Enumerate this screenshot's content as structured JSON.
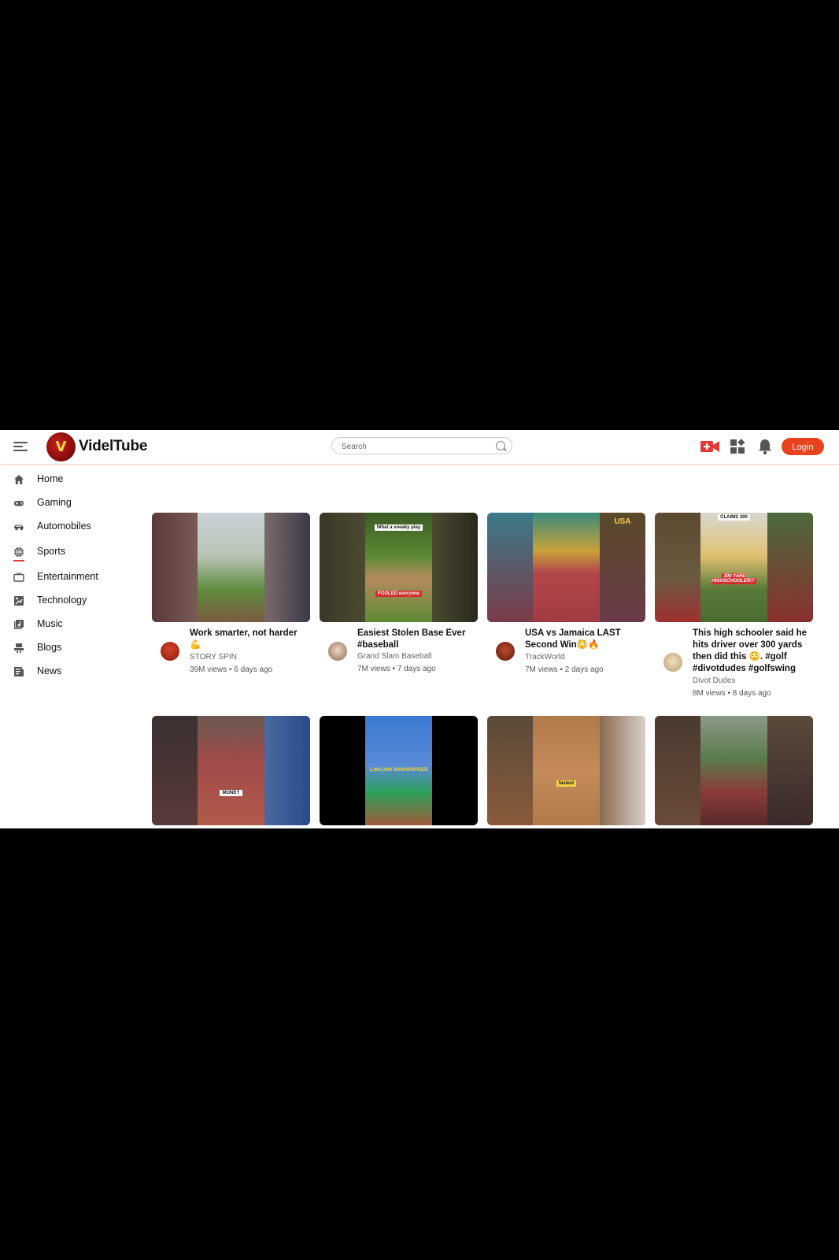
{
  "app": {
    "name": "VidelTube"
  },
  "header": {
    "search_placeholder": "Search",
    "login_label": "Login"
  },
  "sidebar": {
    "items": [
      {
        "label": "Home"
      },
      {
        "label": "Gaming"
      },
      {
        "label": "Automobiles"
      },
      {
        "label": "Sports",
        "active": true
      },
      {
        "label": "Entertainment"
      },
      {
        "label": "Technology"
      },
      {
        "label": "Music"
      },
      {
        "label": "Blogs"
      },
      {
        "label": "News"
      }
    ]
  },
  "colors": {
    "accent": "#e8421f",
    "active_underline": "#e53935"
  },
  "videos": [
    {
      "title": "Work smarter, not harder 💪",
      "channel": "STORY SPIN",
      "meta": "39M views • 6 days ago"
    },
    {
      "title": "Easiest Stolen Base Ever #baseball",
      "channel": "Grand Slam Baseball",
      "meta": "7M views • 7 days ago",
      "thumb_caption_top": "What a sneaky play",
      "thumb_caption_bottom": "FOOLED everyone"
    },
    {
      "title": "USA vs Jamaica LAST Second Win😳🔥",
      "channel": "TrackWorld",
      "meta": "7M views • 2 days ago",
      "thumb_caption_top": "USA"
    },
    {
      "title": "This high schooler said he hits driver over 300 yards then did this 😳. #golf #divotdudes #golfswing",
      "channel": "Divot Dudes",
      "meta": "8M views • 8 days ago",
      "thumb_caption_top": "CLAIMS 300",
      "thumb_caption_bottom": "300 YARD HIGHSCHOOLER!?"
    },
    {
      "thumb_caption_bottom": "MONEY"
    },
    {
      "thumb_caption_bottom": "1,000,000 ISHOWSPEED"
    },
    {
      "thumb_caption_bottom": "fastest"
    },
    {}
  ]
}
